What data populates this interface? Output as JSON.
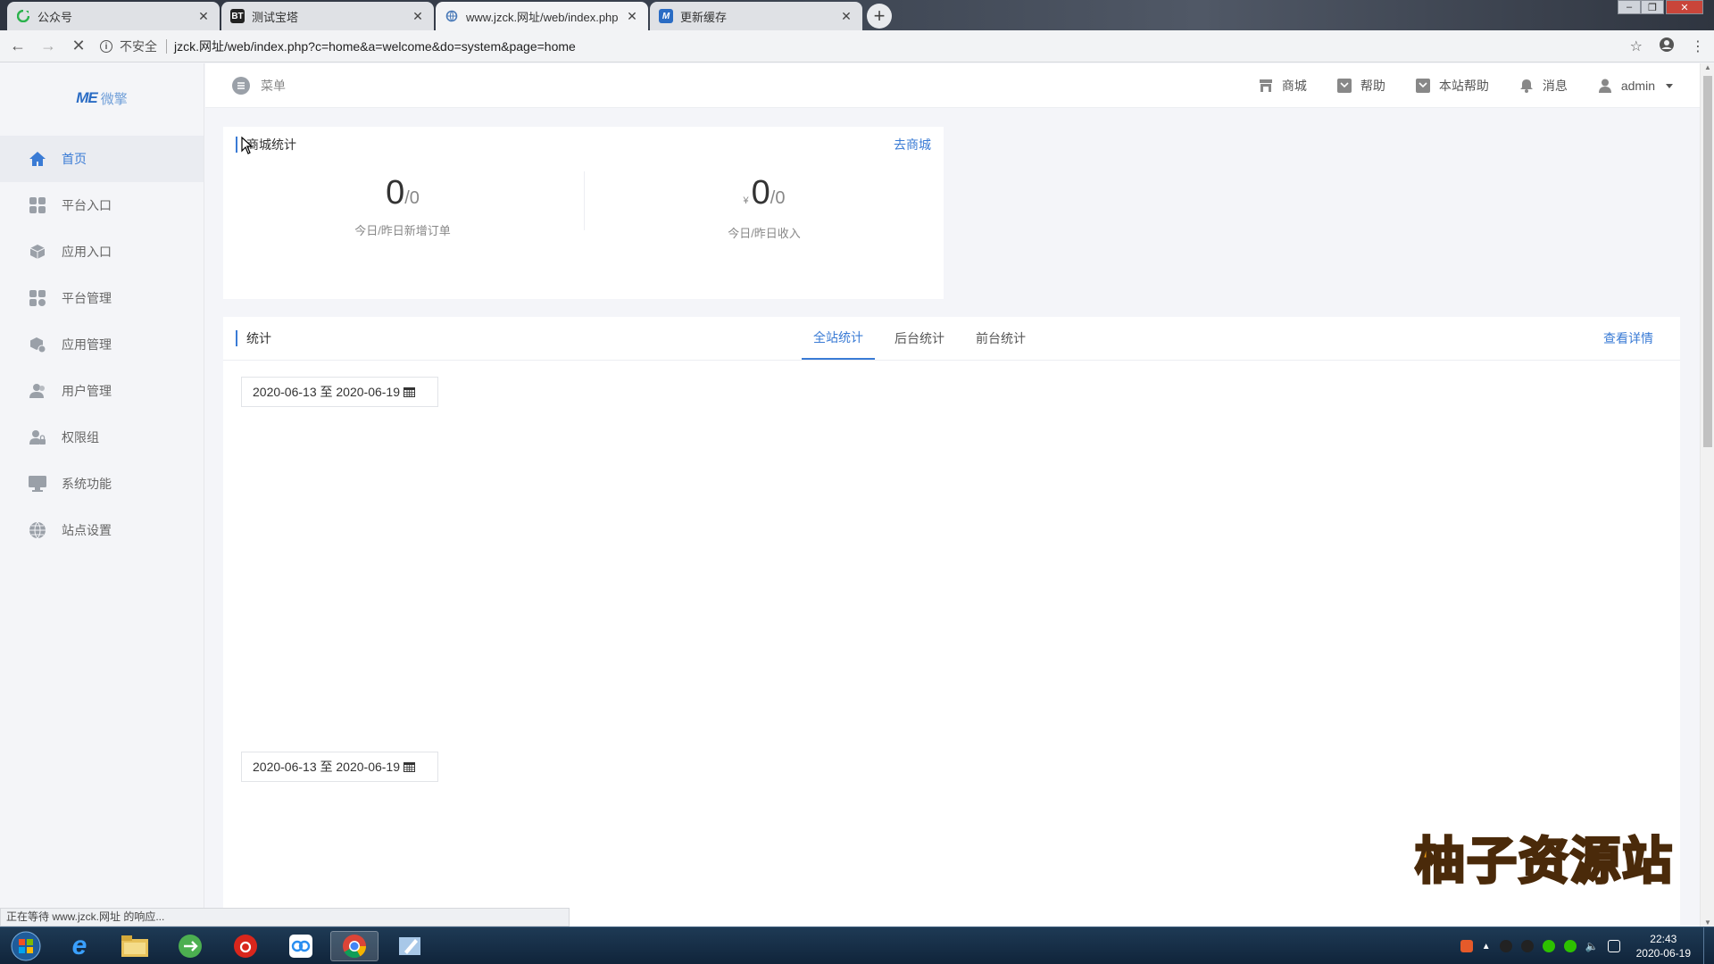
{
  "browser": {
    "tabs": [
      {
        "title": "公众号",
        "favicon": "refresh-green-icon",
        "active": false
      },
      {
        "title": "测试宝塔",
        "favicon": "bt-icon",
        "active": false
      },
      {
        "title": "www.jzck.网址/web/index.php",
        "favicon": "globe-loading-icon",
        "active": true
      },
      {
        "title": "更新缓存",
        "favicon": "m-logo-icon",
        "active": false
      }
    ],
    "security_label": "不安全",
    "url": "jzck.网址/web/index.php?c=home&a=welcome&do=system&page=home",
    "status_text": "正在等待 www.jzck.网址 的响应..."
  },
  "sidebar": {
    "logo_mark": "ME",
    "logo_text": "微擎",
    "items": [
      {
        "label": "首页",
        "icon": "home-icon",
        "active": true
      },
      {
        "label": "平台入口",
        "icon": "grid-icon",
        "active": false
      },
      {
        "label": "应用入口",
        "icon": "cube-icon",
        "active": false
      },
      {
        "label": "平台管理",
        "icon": "grid-manage-icon",
        "active": false
      },
      {
        "label": "应用管理",
        "icon": "cube-gear-icon",
        "active": false
      },
      {
        "label": "用户管理",
        "icon": "users-icon",
        "active": false
      },
      {
        "label": "权限组",
        "icon": "user-lock-icon",
        "active": false
      },
      {
        "label": "系统功能",
        "icon": "monitor-icon",
        "active": false
      },
      {
        "label": "站点设置",
        "icon": "globe-icon",
        "active": false
      }
    ]
  },
  "topbar": {
    "menu_label": "菜单",
    "links": [
      {
        "label": "商城",
        "icon": "store-icon"
      },
      {
        "label": "帮助",
        "icon": "help-icon"
      },
      {
        "label": "本站帮助",
        "icon": "site-help-icon"
      },
      {
        "label": "消息",
        "icon": "bell-icon"
      }
    ],
    "user": "admin"
  },
  "mall_stats": {
    "title": "商城统计",
    "link": "去商城",
    "orders": {
      "today": "0",
      "yesterday": "/0",
      "label": "今日/昨日新增订单"
    },
    "income": {
      "currency": "¥",
      "today": "0",
      "yesterday": "/0",
      "label": "今日/昨日收入"
    }
  },
  "stats": {
    "title": "统计",
    "tabs": [
      "全站统计",
      "后台统计",
      "前台统计"
    ],
    "active_tab": 0,
    "details_link": "查看详情",
    "date_range_1": "2020-06-13 至 2020-06-19",
    "date_range_2": "2020-06-13 至 2020-06-19"
  },
  "watermark": "柚子资源站",
  "taskbar": {
    "time": "22:43",
    "date": "2020-06-19"
  },
  "colors": {
    "accent": "#3a7bd5",
    "sidebar_bg": "#f4f5f8",
    "page_bg": "#f4f5f9"
  }
}
